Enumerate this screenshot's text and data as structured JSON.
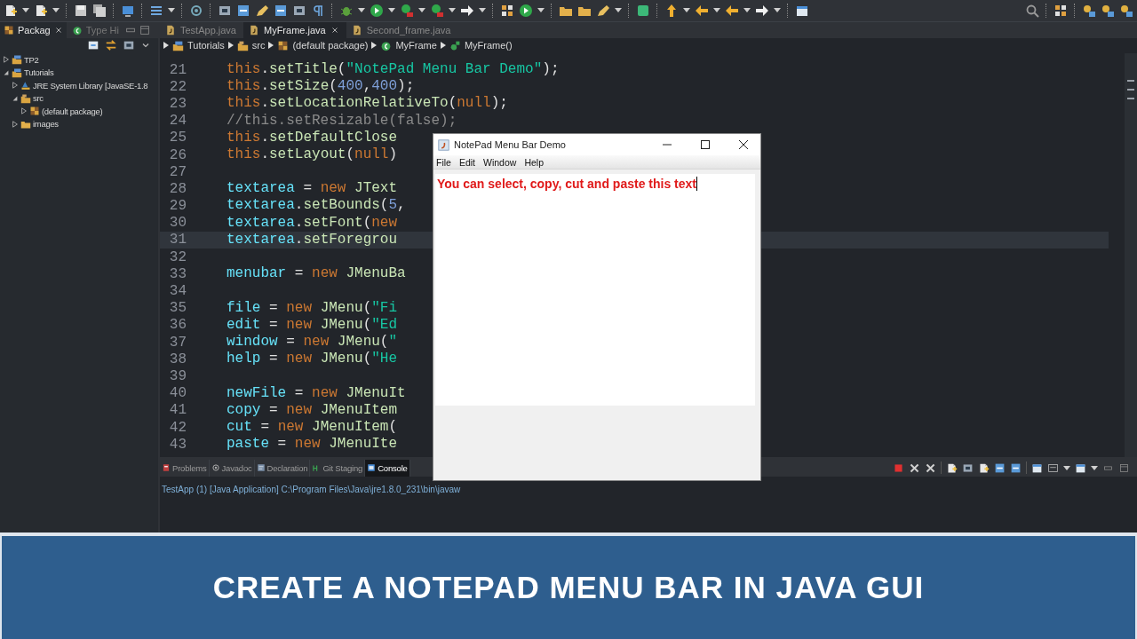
{
  "package_explorer": {
    "tabs": [
      {
        "label": "Packag",
        "selected": true
      },
      {
        "label": "Type Hi",
        "selected": false
      }
    ],
    "tree": [
      {
        "label": "TP2",
        "kind": "project",
        "expanded": false
      },
      {
        "label": "Tutorials",
        "kind": "project",
        "expanded": true,
        "children": [
          {
            "label": "JRE System Library [JavaSE-1.8",
            "kind": "library",
            "expanded": false
          },
          {
            "label": "src",
            "kind": "source",
            "expanded": true,
            "children": [
              {
                "label": "(default package)",
                "kind": "package",
                "expanded": false
              }
            ]
          },
          {
            "label": "images",
            "kind": "folder",
            "expanded": false
          }
        ]
      }
    ]
  },
  "editor": {
    "tabs": [
      {
        "label": "TestApp.java",
        "selected": false
      },
      {
        "label": "MyFrame.java",
        "selected": true
      },
      {
        "label": "Second_frame.java",
        "selected": false
      }
    ],
    "breadcrumb": [
      {
        "label": "Tutorials",
        "kind": "project"
      },
      {
        "label": "src",
        "kind": "source"
      },
      {
        "label": "(default package)",
        "kind": "package"
      },
      {
        "label": "MyFrame",
        "kind": "class"
      },
      {
        "label": "MyFrame()",
        "kind": "method"
      }
    ],
    "lines": [
      {
        "number": "21",
        "current": false,
        "tokens": [
          {
            "kind": "keyword",
            "text": "this"
          },
          {
            "kind": "plain",
            "text": "."
          },
          {
            "kind": "method",
            "text": "setTitle"
          },
          {
            "kind": "plain",
            "text": "("
          },
          {
            "kind": "string",
            "text": "\"NotePad Menu Bar Demo\""
          },
          {
            "kind": "plain",
            "text": ");"
          }
        ]
      },
      {
        "number": "22",
        "current": false,
        "tokens": [
          {
            "kind": "keyword",
            "text": "this"
          },
          {
            "kind": "plain",
            "text": "."
          },
          {
            "kind": "method",
            "text": "setSize"
          },
          {
            "kind": "plain",
            "text": "("
          },
          {
            "kind": "number",
            "text": "400"
          },
          {
            "kind": "plain",
            "text": ","
          },
          {
            "kind": "number",
            "text": "400"
          },
          {
            "kind": "plain",
            "text": ");"
          }
        ]
      },
      {
        "number": "23",
        "current": false,
        "tokens": [
          {
            "kind": "keyword",
            "text": "this"
          },
          {
            "kind": "plain",
            "text": "."
          },
          {
            "kind": "method",
            "text": "setLocationRelativeTo"
          },
          {
            "kind": "plain",
            "text": "("
          },
          {
            "kind": "keyword",
            "text": "null"
          },
          {
            "kind": "plain",
            "text": ");"
          }
        ]
      },
      {
        "number": "24",
        "current": false,
        "tokens": [
          {
            "kind": "comment",
            "text": "//this.setResizable(false);"
          }
        ]
      },
      {
        "number": "25",
        "current": false,
        "tokens": [
          {
            "kind": "keyword",
            "text": "this"
          },
          {
            "kind": "plain",
            "text": "."
          },
          {
            "kind": "method",
            "text": "setDefaultClose"
          }
        ]
      },
      {
        "number": "26",
        "current": false,
        "tokens": [
          {
            "kind": "keyword",
            "text": "this"
          },
          {
            "kind": "plain",
            "text": "."
          },
          {
            "kind": "method",
            "text": "setLayout"
          },
          {
            "kind": "plain",
            "text": "("
          },
          {
            "kind": "keyword",
            "text": "null"
          },
          {
            "kind": "plain",
            "text": ")"
          }
        ]
      },
      {
        "number": "27",
        "current": false
      },
      {
        "number": "28",
        "current": false,
        "tokens": [
          {
            "kind": "field",
            "text": "textarea"
          },
          {
            "kind": "plain",
            "text": " = "
          },
          {
            "kind": "keyword",
            "text": "new"
          },
          {
            "kind": "type",
            "text": " JText"
          }
        ]
      },
      {
        "number": "29",
        "current": false,
        "tokens": [
          {
            "kind": "field",
            "text": "textarea"
          },
          {
            "kind": "plain",
            "text": "."
          },
          {
            "kind": "method",
            "text": "setBounds"
          },
          {
            "kind": "plain",
            "text": "("
          },
          {
            "kind": "number",
            "text": "5"
          },
          {
            "kind": "plain",
            "text": ","
          }
        ]
      },
      {
        "number": "30",
        "current": false,
        "tokens": [
          {
            "kind": "field",
            "text": "textarea"
          },
          {
            "kind": "plain",
            "text": "."
          },
          {
            "kind": "method",
            "text": "setFont"
          },
          {
            "kind": "plain",
            "text": "("
          },
          {
            "kind": "keyword",
            "text": "new"
          }
        ]
      },
      {
        "number": "31",
        "current": true,
        "tokens": [
          {
            "kind": "field",
            "text": "textarea"
          },
          {
            "kind": "plain",
            "text": "."
          },
          {
            "kind": "method",
            "text": "setForegrou"
          }
        ]
      },
      {
        "number": "32",
        "current": false
      },
      {
        "number": "33",
        "current": false,
        "tokens": [
          {
            "kind": "field",
            "text": "menubar"
          },
          {
            "kind": "plain",
            "text": " = "
          },
          {
            "kind": "keyword",
            "text": "new"
          },
          {
            "kind": "type",
            "text": " JMenuBa"
          }
        ]
      },
      {
        "number": "34",
        "current": false
      },
      {
        "number": "35",
        "current": false,
        "tokens": [
          {
            "kind": "field",
            "text": "file"
          },
          {
            "kind": "plain",
            "text": " = "
          },
          {
            "kind": "keyword",
            "text": "new"
          },
          {
            "kind": "type",
            "text": " JMenu"
          },
          {
            "kind": "plain",
            "text": "("
          },
          {
            "kind": "string",
            "text": "\"Fi"
          }
        ]
      },
      {
        "number": "36",
        "current": false,
        "tokens": [
          {
            "kind": "field",
            "text": "edit"
          },
          {
            "kind": "plain",
            "text": " = "
          },
          {
            "kind": "keyword",
            "text": "new"
          },
          {
            "kind": "type",
            "text": " JMenu"
          },
          {
            "kind": "plain",
            "text": "("
          },
          {
            "kind": "string",
            "text": "\"Ed"
          }
        ]
      },
      {
        "number": "37",
        "current": false,
        "tokens": [
          {
            "kind": "field",
            "text": "window"
          },
          {
            "kind": "plain",
            "text": " = "
          },
          {
            "kind": "keyword",
            "text": "new"
          },
          {
            "kind": "type",
            "text": " JMenu"
          },
          {
            "kind": "plain",
            "text": "("
          },
          {
            "kind": "string",
            "text": "\""
          }
        ]
      },
      {
        "number": "38",
        "current": false,
        "tokens": [
          {
            "kind": "field",
            "text": "help"
          },
          {
            "kind": "plain",
            "text": " = "
          },
          {
            "kind": "keyword",
            "text": "new"
          },
          {
            "kind": "type",
            "text": " JMenu"
          },
          {
            "kind": "plain",
            "text": "("
          },
          {
            "kind": "string",
            "text": "\"He"
          }
        ]
      },
      {
        "number": "39",
        "current": false
      },
      {
        "number": "40",
        "current": false,
        "tokens": [
          {
            "kind": "field",
            "text": "newFile"
          },
          {
            "kind": "plain",
            "text": " = "
          },
          {
            "kind": "keyword",
            "text": "new"
          },
          {
            "kind": "type",
            "text": " JMenuIt"
          }
        ]
      },
      {
        "number": "41",
        "current": false,
        "tokens": [
          {
            "kind": "field",
            "text": "copy"
          },
          {
            "kind": "plain",
            "text": " = "
          },
          {
            "kind": "keyword",
            "text": "new"
          },
          {
            "kind": "type",
            "text": " JMenuItem"
          }
        ]
      },
      {
        "number": "42",
        "current": false,
        "tokens": [
          {
            "kind": "field",
            "text": "cut"
          },
          {
            "kind": "plain",
            "text": " = "
          },
          {
            "kind": "keyword",
            "text": "new"
          },
          {
            "kind": "type",
            "text": " JMenuItem"
          },
          {
            "kind": "plain",
            "text": "("
          }
        ]
      },
      {
        "number": "43",
        "current": false,
        "tokens": [
          {
            "kind": "field",
            "text": "paste"
          },
          {
            "kind": "plain",
            "text": " = "
          },
          {
            "kind": "keyword",
            "text": "new"
          },
          {
            "kind": "type",
            "text": " JMenuIte"
          }
        ]
      }
    ]
  },
  "bottom_panel": {
    "tabs": [
      {
        "label": "Problems",
        "selected": false
      },
      {
        "label": "Javadoc",
        "selected": false
      },
      {
        "label": "Declaration",
        "selected": false
      },
      {
        "label": "Git Staging",
        "selected": false
      },
      {
        "label": "Console",
        "selected": true
      }
    ],
    "console_title": "TestApp (1) [Java Application] C:\\Program Files\\Java\\jre1.8.0_231\\bin\\javaw"
  },
  "app_window": {
    "title": "NotePad Menu Bar Demo",
    "menus": [
      "File",
      "Edit",
      "Window",
      "Help"
    ],
    "text": "You can select, copy, cut and paste this text"
  },
  "banner": {
    "title": "CREATE A NOTEPAD MENU BAR IN JAVA GUI"
  }
}
